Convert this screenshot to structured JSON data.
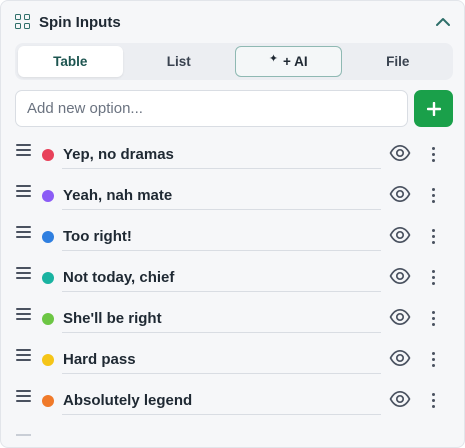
{
  "header": {
    "title": "Spin Inputs",
    "icon": "grid-icon",
    "collapse_icon": "chevron-up-icon"
  },
  "tabs": [
    {
      "label": "Table",
      "active": true
    },
    {
      "label": "List",
      "active": false
    },
    {
      "label": "+ AI",
      "active": false,
      "icon": "sparkle-icon",
      "highlight": true
    },
    {
      "label": "File",
      "active": false
    }
  ],
  "add_option": {
    "placeholder": "Add new option...",
    "value": "",
    "button_icon": "plus-icon",
    "button_color": "#1aa04a"
  },
  "options": [
    {
      "label": "Yep, no dramas",
      "color": "#e8415a"
    },
    {
      "label": "Yeah, nah mate",
      "color": "#8b5cf6"
    },
    {
      "label": "Too right!",
      "color": "#2f7fe0"
    },
    {
      "label": "Not today, chief",
      "color": "#19b3a1"
    },
    {
      "label": "She'll be right",
      "color": "#6cc644"
    },
    {
      "label": "Hard pass",
      "color": "#f5c518"
    },
    {
      "label": "Absolutely legend",
      "color": "#f07a2a"
    }
  ],
  "row_icons": {
    "handle": "drag-handle-icon",
    "visibility": "eye-icon",
    "menu": "more-vertical-icon"
  }
}
